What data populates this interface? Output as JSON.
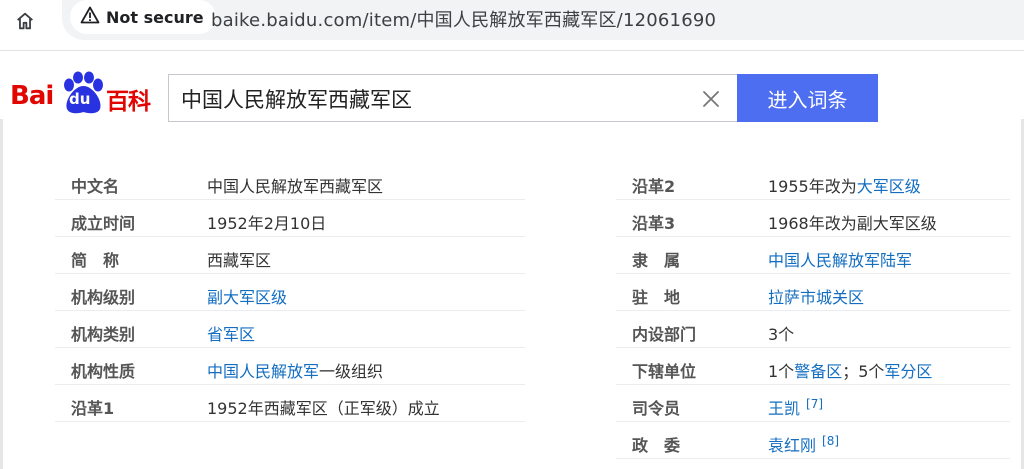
{
  "browser": {
    "security_label": "Not secure",
    "url": "baike.baidu.com/item/中国人民解放军西藏军区/12061690"
  },
  "header": {
    "logo": {
      "bai": "Bai",
      "du": "du",
      "baike": "百科"
    },
    "search_value": "中国人民解放军西藏军区",
    "enter_label": "进入词条"
  },
  "infobox": {
    "left": [
      {
        "label": "中文名",
        "parts": [
          {
            "text": "中国人民解放军西藏军区"
          }
        ]
      },
      {
        "label": "成立时间",
        "parts": [
          {
            "text": "1952年2月10日"
          }
        ]
      },
      {
        "label": "简　称",
        "parts": [
          {
            "text": "西藏军区"
          }
        ]
      },
      {
        "label": "机构级别",
        "parts": [
          {
            "text": "副大军区级",
            "link": true
          }
        ]
      },
      {
        "label": "机构类别",
        "parts": [
          {
            "text": "省军区",
            "link": true
          }
        ]
      },
      {
        "label": "机构性质",
        "parts": [
          {
            "text": "中国人民解放军",
            "link": true
          },
          {
            "text": "一级组织"
          }
        ]
      },
      {
        "label": "沿革1",
        "parts": [
          {
            "text": "1952年西藏军区（正军级）成立"
          }
        ]
      }
    ],
    "right": [
      {
        "label": "沿革2",
        "parts": [
          {
            "text": "1955年改为"
          },
          {
            "text": "大军区级",
            "link": true
          }
        ]
      },
      {
        "label": "沿革3",
        "parts": [
          {
            "text": "1968年改为副大军区级"
          }
        ]
      },
      {
        "label": "隶　属",
        "parts": [
          {
            "text": "中国人民解放军陆军",
            "link": true
          }
        ]
      },
      {
        "label": "驻　地",
        "parts": [
          {
            "text": "拉萨市城关区",
            "link": true
          }
        ]
      },
      {
        "label": "内设部门",
        "parts": [
          {
            "text": "3个"
          }
        ]
      },
      {
        "label": "下辖单位",
        "parts": [
          {
            "text": "1个"
          },
          {
            "text": "警备区",
            "link": true
          },
          {
            "text": "；5个"
          },
          {
            "text": "军分区",
            "link": true
          }
        ]
      },
      {
        "label": "司令员",
        "parts": [
          {
            "text": "王凯",
            "link": true
          },
          {
            "text": "[7]",
            "ref": true
          }
        ]
      },
      {
        "label": "政　委",
        "parts": [
          {
            "text": "袁红刚",
            "link": true
          },
          {
            "text": "[8]",
            "ref": true
          }
        ]
      }
    ]
  }
}
